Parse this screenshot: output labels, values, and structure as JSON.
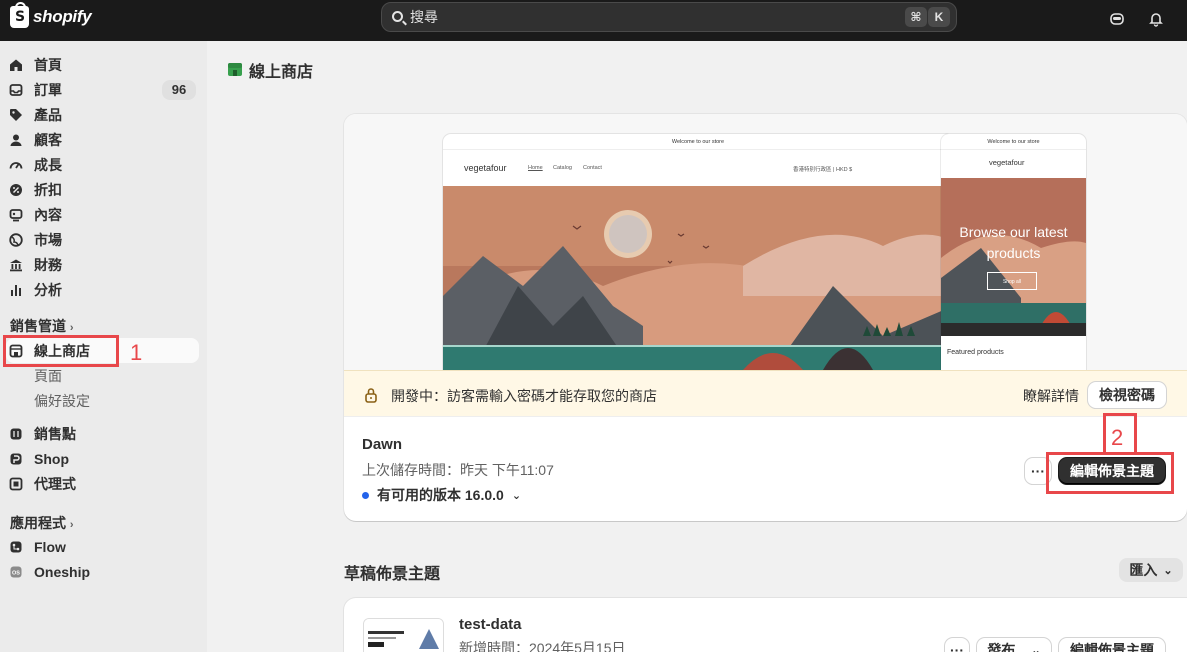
{
  "topbar": {
    "brand": "shopify",
    "search_placeholder": "搜尋",
    "shortcut_cmd": "⌘",
    "shortcut_key": "K"
  },
  "sidebar": {
    "items": [
      {
        "label": "首頁",
        "icon": "home-icon"
      },
      {
        "label": "訂單",
        "icon": "inbox-icon",
        "badge": "96"
      },
      {
        "label": "產品",
        "icon": "tag-icon"
      },
      {
        "label": "顧客",
        "icon": "person-icon"
      },
      {
        "label": "成長",
        "icon": "gauge-icon"
      },
      {
        "label": "折扣",
        "icon": "discount-icon"
      },
      {
        "label": "內容",
        "icon": "content-icon"
      },
      {
        "label": "市場",
        "icon": "globe-icon"
      },
      {
        "label": "財務",
        "icon": "bank-icon"
      },
      {
        "label": "分析",
        "icon": "bar-chart-icon"
      }
    ],
    "sales_channels_label": "銷售管道",
    "online_store": "線上商店",
    "online_store_sub": [
      "頁面",
      "偏好設定"
    ],
    "channels": [
      {
        "label": "銷售點",
        "icon": "pos-icon"
      },
      {
        "label": "Shop",
        "icon": "shop-icon"
      },
      {
        "label": "代理式",
        "icon": "agentic-icon"
      }
    ],
    "apps_label": "應用程式",
    "apps": [
      {
        "label": "Flow",
        "icon": "flow-icon"
      },
      {
        "label": "Oneship",
        "icon": "oneship-icon"
      }
    ]
  },
  "annotations": {
    "one": "1",
    "two": "2"
  },
  "main": {
    "title": "線上商店",
    "preview": {
      "announcement": "Welcome to our store",
      "brand": "vegetafour",
      "nav": [
        "Home",
        "Catalog",
        "Contact"
      ],
      "currency": "香港特別行政區 | HKD $",
      "hero_text": "Browse our latest products",
      "shop_all": "Shop all",
      "featured": "Featured products"
    },
    "dev_banner": {
      "text": "開發中：訪客需輸入密碼才能存取您的商店",
      "learn_more": "瞭解詳情",
      "view_password": "檢視密碼"
    },
    "current_theme": {
      "name": "Dawn",
      "saved": "上次儲存時間：昨天 下午11:07",
      "version": "有可用的版本 16.0.0",
      "more": "···",
      "edit": "編輯佈景主題"
    },
    "drafts": {
      "title": "草稿佈景主題",
      "import": "匯入",
      "theme_name": "test-data",
      "theme_date": "新增時間：2024年5月15日",
      "more": "···",
      "publish": "發布",
      "edit": "編輯佈景主題"
    }
  },
  "colors": {
    "topbar": "#1a1a1a",
    "annotation": "#e8474a",
    "accent_dot": "#2463eb"
  }
}
